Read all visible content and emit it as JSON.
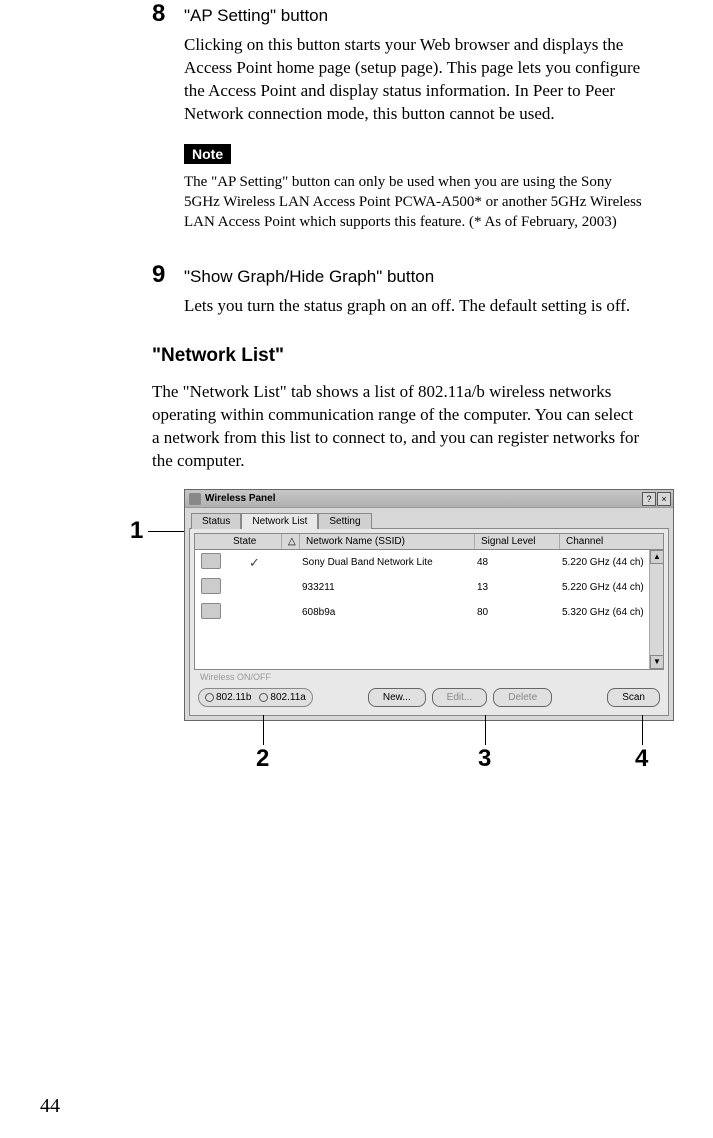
{
  "item8": {
    "number": "8",
    "title": "\"AP Setting\" button",
    "body": "Clicking on this button starts your Web browser and displays the Access Point home page (setup page). This page lets you configure the Access Point and display status information. In Peer to Peer Network connection mode, this button cannot be used."
  },
  "note": {
    "label": "Note",
    "text": "The \"AP Setting\" button can only be used when you are using the Sony 5GHz Wireless LAN Access Point PCWA-A500* or another 5GHz Wireless LAN Access Point which supports this feature. (* As of February, 2003)"
  },
  "item9": {
    "number": "9",
    "title": "\"Show Graph/Hide Graph\" button",
    "body": "Lets you turn the status graph on an off. The default setting is off."
  },
  "networkList": {
    "heading": "\"Network List\"",
    "body": "The \"Network List\" tab shows a list of 802.11a/b wireless networks operating within communication range of the computer. You can select a network from this list to connect to, and you can register networks for the computer."
  },
  "window": {
    "title": "Wireless Panel",
    "tabs": {
      "status": "Status",
      "networkList": "Network List",
      "setting": "Setting"
    },
    "columns": {
      "state": "State",
      "ssid": "Network Name (SSID)",
      "signal": "Signal Level",
      "channel": "Channel"
    },
    "rows": [
      {
        "connected": true,
        "ssid": "Sony Dual Band Network Lite",
        "signal": "48",
        "channel": "5.220 GHz (44 ch)"
      },
      {
        "connected": false,
        "ssid": "933211",
        "signal": "13",
        "channel": "5.220 GHz (44 ch)"
      },
      {
        "connected": false,
        "ssid": "608b9a",
        "signal": "80",
        "channel": "5.320 GHz (64 ch)"
      }
    ],
    "wirelessOnOff": "Wireless ON/OFF",
    "radios": {
      "b": "802.11b",
      "a": "802.11a"
    },
    "buttons": {
      "new": "New...",
      "edit": "Edit...",
      "delete": "Delete",
      "scan": "Scan"
    },
    "help": "?",
    "close": "×",
    "sort": "△"
  },
  "callouts": {
    "c1": "1",
    "c2": "2",
    "c3": "3",
    "c4": "4"
  },
  "pageNumber": "44"
}
